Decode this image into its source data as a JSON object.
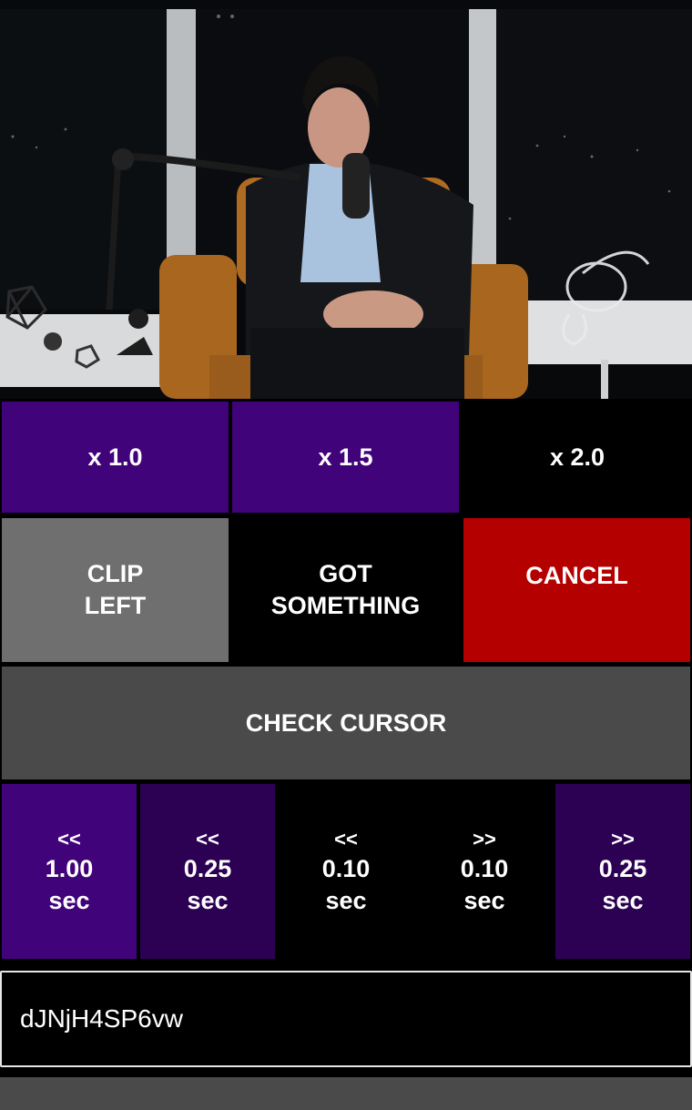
{
  "speed": {
    "x1": "x 1.0",
    "x15": "x 1.5",
    "x2": "x 2.0"
  },
  "actions": {
    "clip_left_line1": "CLIP",
    "clip_left_line2": "LEFT",
    "got_something_line1": "GOT",
    "got_something_line2": "SOMETHING",
    "cancel": "CANCEL",
    "check_cursor": "CHECK CURSOR"
  },
  "seek": [
    {
      "dir": "<<",
      "amount": "1.00",
      "unit": "sec"
    },
    {
      "dir": "<<",
      "amount": "0.25",
      "unit": "sec"
    },
    {
      "dir": "<<",
      "amount": "0.10",
      "unit": "sec"
    },
    {
      "dir": ">>",
      "amount": "0.10",
      "unit": "sec"
    },
    {
      "dir": ">>",
      "amount": "0.25",
      "unit": "sec"
    }
  ],
  "video_id": "dJNjH4SP6vw",
  "colors": {
    "purple": "#41037a",
    "dark_purple": "#2c0153",
    "cancel_red": "#b50000",
    "clip_gray": "#6f6f6f",
    "check_gray": "#4a4a4a"
  }
}
